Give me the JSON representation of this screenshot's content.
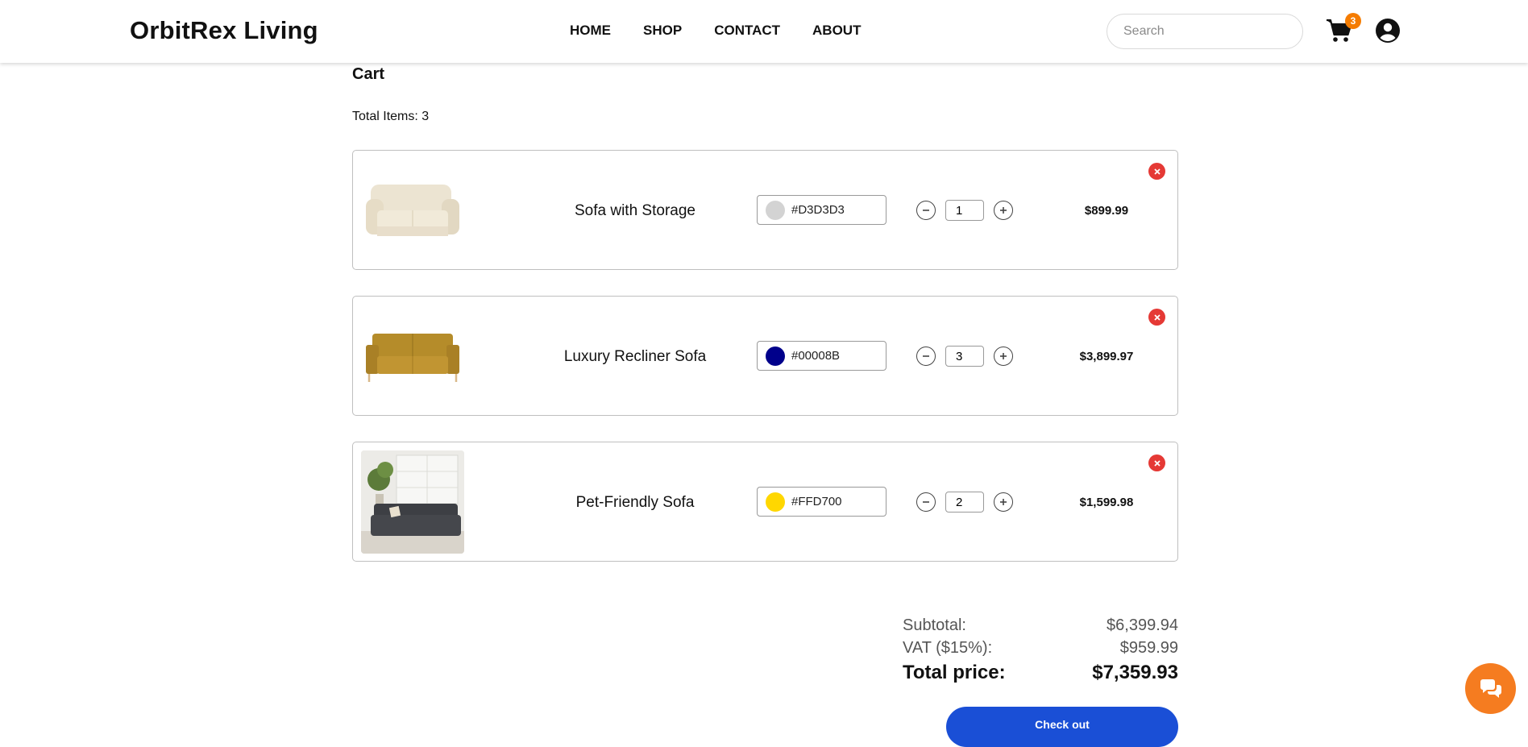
{
  "header": {
    "logo": "OrbitRex Living",
    "nav": [
      "HOME",
      "SHOP",
      "CONTACT",
      "ABOUT"
    ],
    "search_placeholder": "Search",
    "cart_count": "3"
  },
  "cart": {
    "title": "Cart",
    "total_items": "Total Items: 3",
    "items": [
      {
        "name": "Sofa with Storage",
        "color_hex": "#D3D3D3",
        "swatch": "#D3D3D3",
        "quantity": "1",
        "price": "$899.99",
        "image": "cream-sofa"
      },
      {
        "name": "Luxury Recliner Sofa",
        "color_hex": "#00008B",
        "swatch": "#00008B",
        "quantity": "3",
        "price": "$3,899.97",
        "image": "mustard-sofa"
      },
      {
        "name": "Pet-Friendly Sofa",
        "color_hex": "#FFD700",
        "swatch": "#FFD700",
        "quantity": "2",
        "price": "$1,599.98",
        "image": "dark-sofa-room"
      }
    ]
  },
  "summary": {
    "subtotal_label": "Subtotal:",
    "subtotal_value": "$6,399.94",
    "vat_label": "VAT ($15%):",
    "vat_value": "$959.99",
    "total_label": "Total price:",
    "total_value": "$7,359.93",
    "checkout_label": "Check out"
  },
  "colors": {
    "accent": "#1A4FD6",
    "badge": "#F57C00",
    "remove": "#E53935",
    "chat": "#F57C20"
  }
}
